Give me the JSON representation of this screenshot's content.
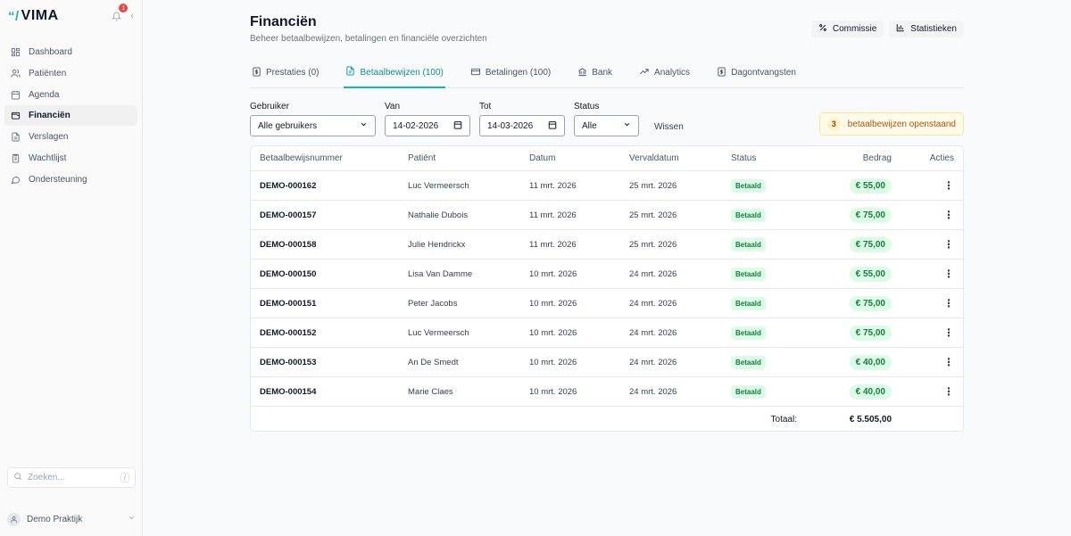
{
  "sidebar": {
    "logo": "VIMA",
    "notification_count": "1",
    "nav": [
      {
        "label": "Dashboard",
        "icon": "grid-icon"
      },
      {
        "label": "Patiënten",
        "icon": "users-icon"
      },
      {
        "label": "Agenda",
        "icon": "calendar-icon"
      },
      {
        "label": "Financiën",
        "icon": "wallet-icon",
        "active": true
      },
      {
        "label": "Verslagen",
        "icon": "document-icon"
      },
      {
        "label": "Wachtlijst",
        "icon": "clipboard-icon"
      },
      {
        "label": "Ondersteuning",
        "icon": "chat-icon"
      }
    ],
    "search_placeholder": "Zoeken...",
    "search_shortcut": "/",
    "user_name": "Demo Praktijk"
  },
  "header": {
    "title": "Financiën",
    "subtitle": "Beheer betaalbewijzen, betalingen en financiële overzichten",
    "commission_label": "Commissie",
    "statistics_label": "Statistieken"
  },
  "tabs": [
    {
      "label": "Prestaties (0)",
      "icon": "dollar-doc-icon"
    },
    {
      "label": "Betaalbewijzen (100)",
      "icon": "file-icon",
      "active": true
    },
    {
      "label": "Betalingen (100)",
      "icon": "card-icon"
    },
    {
      "label": "Bank",
      "icon": "bank-icon"
    },
    {
      "label": "Analytics",
      "icon": "trend-icon"
    },
    {
      "label": "Dagontvangsten",
      "icon": "dollar-doc-icon"
    }
  ],
  "filters": {
    "user_label": "Gebruiker",
    "user_value": "Alle gebruikers",
    "from_label": "Van",
    "from_value": "14-02-2026",
    "to_label": "Tot",
    "to_value": "14-03-2026",
    "status_label": "Status",
    "status_value": "Alle",
    "clear_label": "Wissen",
    "pending_count": "3",
    "pending_text": "betaalbewijzen openstaand"
  },
  "table": {
    "columns": [
      "Betaalbewijsnummer",
      "Patiënt",
      "Datum",
      "Vervaldatum",
      "Status",
      "Bedrag",
      "Acties"
    ],
    "rows": [
      {
        "number": "DEMO-000162",
        "patient": "Luc Vermeersch",
        "date": "11 mrt. 2026",
        "due": "25 mrt. 2026",
        "status": "Betaald",
        "amount": "€ 55,00"
      },
      {
        "number": "DEMO-000157",
        "patient": "Nathalie Dubois",
        "date": "11 mrt. 2026",
        "due": "25 mrt. 2026",
        "status": "Betaald",
        "amount": "€ 75,00"
      },
      {
        "number": "DEMO-000158",
        "patient": "Julie Hendrickx",
        "date": "11 mrt. 2026",
        "due": "25 mrt. 2026",
        "status": "Betaald",
        "amount": "€ 75,00"
      },
      {
        "number": "DEMO-000150",
        "patient": "Lisa Van Damme",
        "date": "10 mrt. 2026",
        "due": "24 mrt. 2026",
        "status": "Betaald",
        "amount": "€ 55,00"
      },
      {
        "number": "DEMO-000151",
        "patient": "Peter Jacobs",
        "date": "10 mrt. 2026",
        "due": "24 mrt. 2026",
        "status": "Betaald",
        "amount": "€ 75,00"
      },
      {
        "number": "DEMO-000152",
        "patient": "Luc Vermeersch",
        "date": "10 mrt. 2026",
        "due": "24 mrt. 2026",
        "status": "Betaald",
        "amount": "€ 75,00"
      },
      {
        "number": "DEMO-000153",
        "patient": "An De Smedt",
        "date": "10 mrt. 2026",
        "due": "24 mrt. 2026",
        "status": "Betaald",
        "amount": "€ 40,00"
      },
      {
        "number": "DEMO-000154",
        "patient": "Marie Claes",
        "date": "10 mrt. 2026",
        "due": "24 mrt. 2026",
        "status": "Betaald",
        "amount": "€ 40,00"
      }
    ],
    "total_label": "Totaal:",
    "total_value": "€ 5.505,00"
  },
  "colors": {
    "accent": "#14b8a6",
    "paid_bg": "#dcfce7",
    "paid_text": "#15803d",
    "warning_bg": "#fffbeb",
    "warning_text": "#b45309"
  }
}
